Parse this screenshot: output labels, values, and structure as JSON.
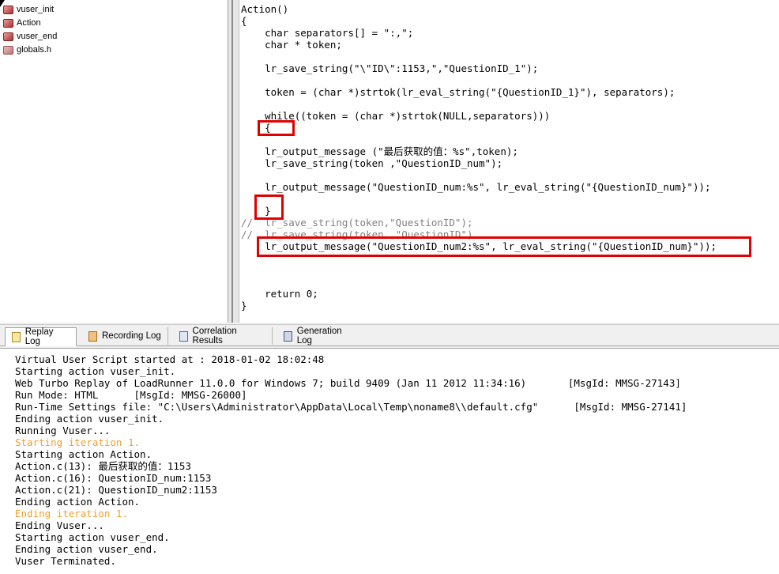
{
  "tree": {
    "items": [
      {
        "label": "vuser_init",
        "icon": "script-file-icon"
      },
      {
        "label": "Action",
        "icon": "script-file-icon"
      },
      {
        "label": "vuser_end",
        "icon": "script-file-icon"
      },
      {
        "label": "globals.h",
        "icon": "header-file-icon"
      }
    ]
  },
  "code": {
    "lines": [
      "Action()",
      "{",
      "    char separators[] = \":,\";",
      "    char * token;",
      "",
      "    lr_save_string(\"\\\"ID\\\":1153,\",\"QuestionID_1\");",
      "",
      "    token = (char *)strtok(lr_eval_string(\"{QuestionID_1}\"), separators);",
      "",
      "    while((token = (char *)strtok(NULL,separators)))",
      "    {",
      "",
      "    lr_output_message (\"最后获取的值：%s\",token);",
      "    lr_save_string(token ,\"QuestionID_num\");",
      "",
      "    lr_output_message(\"QuestionID_num:%s\", lr_eval_string(\"{QuestionID_num}\"));",
      "",
      "    }",
      "//  lr_save_string(token,\"QuestionID\");",
      "//  lr_save_string(token ,\"QuestionID\")",
      "    lr_output_message(\"QuestionID_num2:%s\", lr_eval_string(\"{QuestionID_num}\"));",
      "",
      "",
      "",
      "    return 0;",
      "}"
    ]
  },
  "tabs": [
    {
      "label": "Replay Log",
      "active": true,
      "icon": "replay-log-icon"
    },
    {
      "label": "Recording Log",
      "active": false,
      "icon": "recording-log-icon"
    },
    {
      "label": "Correlation Results",
      "active": false,
      "icon": "correlation-icon"
    },
    {
      "label": "Generation Log",
      "active": false,
      "icon": "generation-log-icon"
    }
  ],
  "log": {
    "lines": [
      "Virtual User Script started at : 2018-01-02 18:02:48",
      "Starting action vuser_init.",
      "Web Turbo Replay of LoadRunner 11.0.0 for Windows 7; build 9409 (Jan 11 2012 11:34:16)       [MsgId: MMSG-27143]",
      "Run Mode: HTML      [MsgId: MMSG-26000]",
      "Run-Time Settings file: \"C:\\Users\\Administrator\\AppData\\Local\\Temp\\noname8\\\\default.cfg\"      [MsgId: MMSG-27141]",
      "Ending action vuser_init.",
      "Running Vuser...",
      "Starting iteration 1.",
      "Starting action Action.",
      "Action.c(13): 最后获取的值：1153",
      "Action.c(16): QuestionID_num:1153",
      "Action.c(21): QuestionID_num2:1153",
      "Ending action Action.",
      "Ending iteration 1.",
      "Ending Vuser...",
      "Starting action vuser_end.",
      "Ending action vuser_end.",
      "Vuser Terminated."
    ]
  },
  "colors": {
    "highlight": "#e00000",
    "keyword": "#0000ff",
    "iteration_text": "#f0a030",
    "value_text": "#2a6aa8"
  }
}
